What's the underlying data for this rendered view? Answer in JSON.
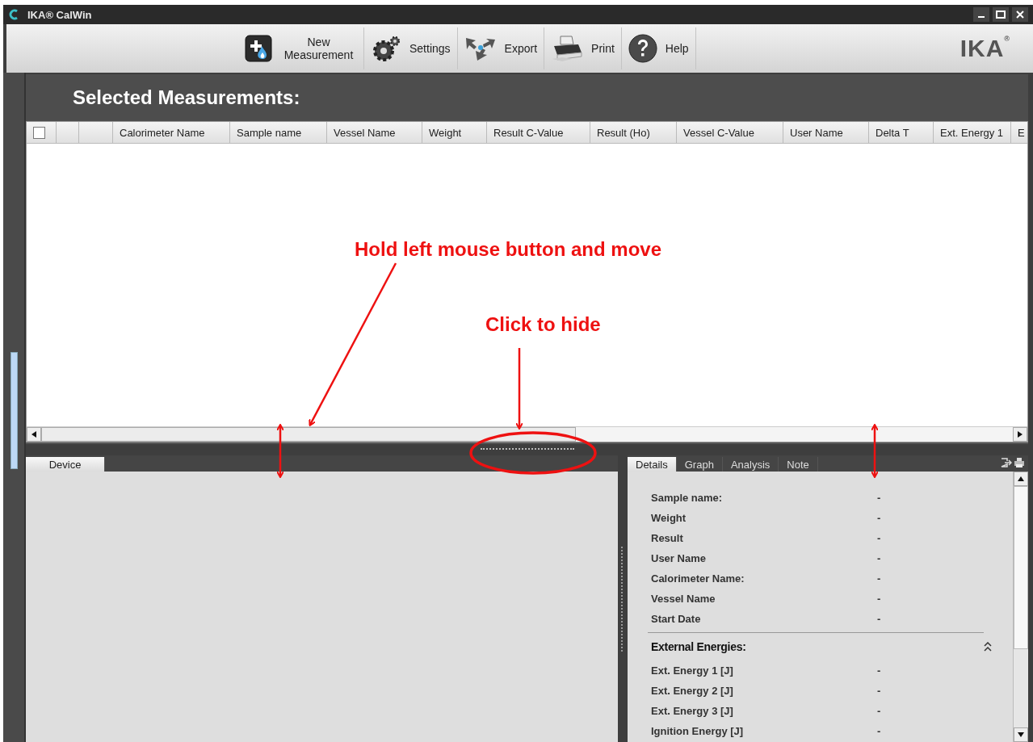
{
  "window": {
    "title": "IKA® CalWin"
  },
  "toolbar": {
    "buttons": [
      {
        "kind": "new-measurement",
        "label": "New Measurement"
      },
      {
        "kind": "settings",
        "label": "Settings"
      },
      {
        "kind": "export",
        "label": "Export"
      },
      {
        "kind": "print",
        "label": "Print"
      },
      {
        "kind": "help",
        "label": "Help"
      }
    ],
    "logo": "IKA$^{®}$"
  },
  "heading": "Selected Measurements:",
  "table": {
    "select_all": {
      "checked": false
    },
    "columns": [
      "Calorimeter Name",
      "Sample name",
      "Vessel Name",
      "Weight",
      "Result C-Value",
      "Result (Ho)",
      "Vessel C-Value",
      "User Name",
      "Delta T",
      "Ext. Energy 1",
      "E"
    ]
  },
  "left_panel": {
    "tabs": [
      {
        "label": "Device",
        "selected": true
      }
    ]
  },
  "right_panel": {
    "tabs": [
      {
        "label": "Details",
        "selected": true
      },
      {
        "label": "Graph",
        "selected": false
      },
      {
        "label": "Analysis",
        "selected": false
      },
      {
        "label": "Note",
        "selected": false
      }
    ],
    "details": [
      {
        "label": "Sample name:",
        "value": "-"
      },
      {
        "label": "Weight",
        "value": "-"
      },
      {
        "label": "Result",
        "value": "-"
      },
      {
        "label": "User Name",
        "value": "-"
      },
      {
        "label": "Calorimeter Name:",
        "value": "-"
      },
      {
        "label": "Vessel Name",
        "value": "-"
      },
      {
        "label": "Start Date",
        "value": "-"
      }
    ],
    "section": {
      "title": "External Energies:",
      "expanded": true,
      "rows": [
        {
          "label": "Ext. Energy 1 [J]",
          "value": "-"
        },
        {
          "label": "Ext. Energy 2 [J]",
          "value": "-"
        },
        {
          "label": "Ext. Energy 3 [J]",
          "value": "-"
        },
        {
          "label": "Ignition Energy [J]",
          "value": "-"
        }
      ]
    }
  },
  "annotations": [
    {
      "text": "Hold left mouse button and move"
    },
    {
      "text": "Click to hide"
    }
  ]
}
